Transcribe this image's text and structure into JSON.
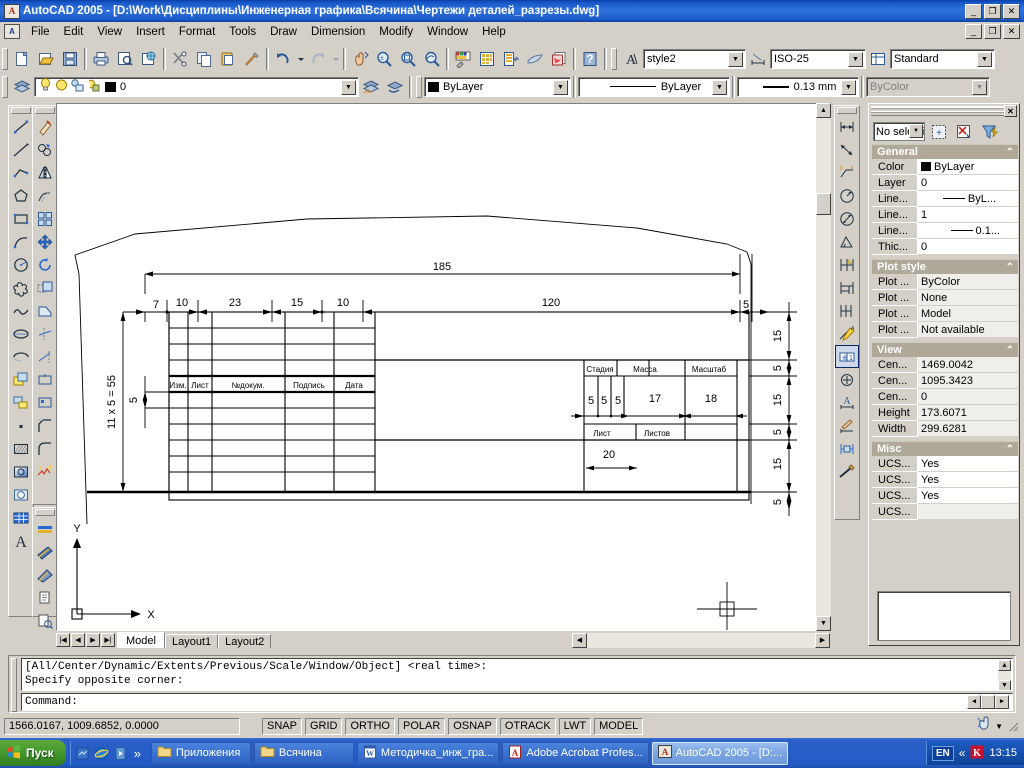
{
  "window": {
    "app_icon": "autocad-icon",
    "title": "AutoCAD 2005 - [D:\\Work\\Дисциплины\\Инженерная графика\\Всячина\\Чертежи деталей_разрезы.dwg]",
    "minimize": "_",
    "maximize": "❐",
    "close": "✕",
    "doc_minimize": "_",
    "doc_restore": "❐",
    "doc_close": "✕"
  },
  "menu": {
    "items": [
      "File",
      "Edit",
      "View",
      "Insert",
      "Format",
      "Tools",
      "Draw",
      "Dimension",
      "Modify",
      "Window",
      "Help"
    ]
  },
  "toolbars": {
    "standard_icons": [
      "new-icon",
      "open-icon",
      "save-icon",
      "plot-icon",
      "plot-preview-icon",
      "publish-icon",
      "cut-icon",
      "copy-icon",
      "paste-icon",
      "match-properties-icon",
      "undo-icon",
      "undo-dropdown-icon",
      "redo-icon",
      "redo-dropdown-icon",
      "pan-realtime-icon",
      "zoom-realtime-icon",
      "zoom-window-icon",
      "zoom-previous-icon",
      "properties-icon",
      "designcenter-icon",
      "toolpalettes-icon",
      "markup-icon",
      "dbconnect-icon",
      "help-icon"
    ],
    "text_style": {
      "icon": "text-style-icon",
      "value": "style2"
    },
    "dim_style": {
      "icon": "dim-style-icon",
      "value": "ISO-25"
    },
    "table_style": {
      "icon": "table-style-icon",
      "value": "Standard"
    },
    "layer": {
      "layers_icon": "layers-manager-icon",
      "state_icons": [
        "lightbulb-on-icon",
        "freeze-sun-icon",
        "lock-open-icon",
        "plot-on-icon"
      ],
      "value": "0",
      "prev_icon": "layer-previous-icon",
      "make_current_icon": "make-object-layer-current-icon"
    },
    "color": {
      "value": "ByLayer",
      "swatch": "#000000"
    },
    "linetype": {
      "value": "ByLayer"
    },
    "lineweight": {
      "value": "0.13 mm"
    },
    "plotstyle": {
      "value": "ByColor",
      "disabled": true
    }
  },
  "left_toolbar_draw": [
    "line-icon",
    "construction-line-icon",
    "polyline-icon",
    "polygon-icon",
    "rectangle-icon",
    "arc-icon",
    "circle-icon",
    "revision-cloud-icon",
    "spline-icon",
    "ellipse-icon",
    "ellipse-arc-icon",
    "insert-block-icon",
    "make-block-icon",
    "point-icon",
    "hatch-icon",
    "gradient-icon",
    "region-icon",
    "table-icon",
    "multiline-text-icon"
  ],
  "left_toolbar_modify": [
    "erase-icon",
    "copy-object-icon",
    "mirror-icon",
    "offset-icon",
    "array-icon",
    "move-icon",
    "rotate-icon",
    "scale-icon",
    "stretch-icon",
    "trim-icon",
    "extend-icon",
    "break-at-point-icon",
    "break-icon",
    "chamfer-icon",
    "fillet-icon",
    "explode-icon"
  ],
  "left_toolbar_extra": [
    "multiline-icon",
    "dim-linear-icon",
    "dim-aligned-icon",
    "dim-baseline-icon",
    "quick-leader-icon",
    "edit-attribute-icon"
  ],
  "right_toolbar_dim": [
    "dim-linear-icon",
    "dim-aligned-icon",
    "dim-ordinate-icon",
    "dim-radius-icon",
    "dim-diameter-icon",
    "dim-angular-icon",
    "dim-quick-icon",
    "dim-baseline-icon",
    "dim-continue-icon",
    "quick-leader-icon",
    "tolerance-icon",
    "center-mark-icon",
    "dim-edit-text-icon",
    "dim-edit-icon",
    "dim-update-icon",
    "dim-style-control-icon"
  ],
  "drawing": {
    "dimensions_top": [
      {
        "label": "185",
        "note": "overall"
      },
      {
        "label": "7"
      },
      {
        "label": "10"
      },
      {
        "label": "23"
      },
      {
        "label": "15"
      },
      {
        "label": "10"
      },
      {
        "label": "120"
      },
      {
        "label": "5"
      }
    ],
    "dimensions_left": [
      "11 x 5 = 55",
      "5"
    ],
    "dimensions_right": [
      "15",
      "5",
      "15",
      "5",
      "15",
      "5"
    ],
    "dimensions_titleblock": [
      "5",
      "5",
      "5",
      "17",
      "18",
      "20"
    ],
    "titleblock_labels": {
      "izm": "Изм.",
      "list": "Лист",
      "num_dokum": "№докум.",
      "podpis": "Подпись",
      "data": "Дата",
      "stadia": "Стадия",
      "massa": "Масса",
      "masshtab": "Масштаб",
      "list2": "Лист",
      "listov": "Листов"
    },
    "ucs_labels": {
      "x": "X",
      "y": "Y"
    }
  },
  "tabs": {
    "nav": [
      "first-tab-icon",
      "prev-tab-icon",
      "next-tab-icon",
      "last-tab-icon"
    ],
    "items": [
      {
        "label": "Model",
        "active": true
      },
      {
        "label": "Layout1",
        "active": false
      },
      {
        "label": "Layout2",
        "active": false
      }
    ]
  },
  "palette": {
    "close_label": "✕",
    "selection": "No selection",
    "buttons": [
      "quick-select-icon",
      "toggle-pickadd-icon",
      "select-objects-icon"
    ],
    "groups": [
      {
        "title": "General",
        "collapse_icon": "chevron-up-icon",
        "rows": [
          {
            "key": "Color",
            "value": "ByLayer",
            "swatch": true
          },
          {
            "key": "Layer",
            "value": "0"
          },
          {
            "key": "Line...",
            "value": "ByL...",
            "line": true
          },
          {
            "key": "Line...",
            "value": "1"
          },
          {
            "key": "Line...",
            "value": "0.1...",
            "line": true
          },
          {
            "key": "Thic...",
            "value": "0"
          }
        ]
      },
      {
        "title": "Plot style",
        "collapse_icon": "chevron-up-icon",
        "rows": [
          {
            "key": "Plot ...",
            "value": "ByColor",
            "gray": true
          },
          {
            "key": "Plot ...",
            "value": "None",
            "gray": true
          },
          {
            "key": "Plot ...",
            "value": "Model",
            "gray": true
          },
          {
            "key": "Plot ...",
            "value": "Not available",
            "gray": true
          }
        ]
      },
      {
        "title": "View",
        "collapse_icon": "chevron-up-icon",
        "rows": [
          {
            "key": "Cen...",
            "value": "1469.0042"
          },
          {
            "key": "Cen...",
            "value": "1095.3423"
          },
          {
            "key": "Cen...",
            "value": "0"
          },
          {
            "key": "Height",
            "value": "173.6071"
          },
          {
            "key": "Width",
            "value": "299.6281"
          }
        ]
      },
      {
        "title": "Misc",
        "collapse_icon": "chevron-up-icon",
        "rows": [
          {
            "key": "UCS...",
            "value": "Yes"
          },
          {
            "key": "UCS...",
            "value": "Yes"
          },
          {
            "key": "UCS...",
            "value": "Yes"
          },
          {
            "key": "UCS...",
            "value": "",
            "gray": true
          }
        ]
      }
    ]
  },
  "command": {
    "history_line1": "[All/Center/Dynamic/Extents/Previous/Scale/Window/Object] <real time>:",
    "history_line2": "Specify opposite corner:",
    "prompt": "Command:"
  },
  "status": {
    "coordinates": "1566.0167, 1009.6852, 0.0000",
    "toggles": [
      "SNAP",
      "GRID",
      "ORTHO",
      "POLAR",
      "OSNAP",
      "OTRACK",
      "LWT",
      "MODEL"
    ],
    "tray_icon": "communication-center-icon",
    "expand_icon": "chevron-down-icon"
  },
  "taskbar": {
    "start_label": "Пуск",
    "start_icon": "windows-flag-icon",
    "quick_launch": [
      "show-desktop-icon",
      "internet-explorer-icon",
      "media-player-icon"
    ],
    "quick_more": "»",
    "tasks": [
      {
        "label": "Приложения",
        "icon": "folder-icon",
        "active": false
      },
      {
        "label": "Всячина",
        "icon": "folder-icon",
        "active": false
      },
      {
        "label": "Методичка_инж_гра...",
        "icon": "word-icon",
        "active": false
      },
      {
        "label": "Adobe Acrobat Profes...",
        "icon": "acrobat-icon",
        "active": false
      },
      {
        "label": "AutoCAD 2005 - [D:...",
        "icon": "autocad-icon",
        "active": true
      }
    ],
    "tray_lang": "EN",
    "tray_expand": "«",
    "tray_icons": [
      "kaspersky-icon"
    ],
    "clock": "13:15"
  }
}
